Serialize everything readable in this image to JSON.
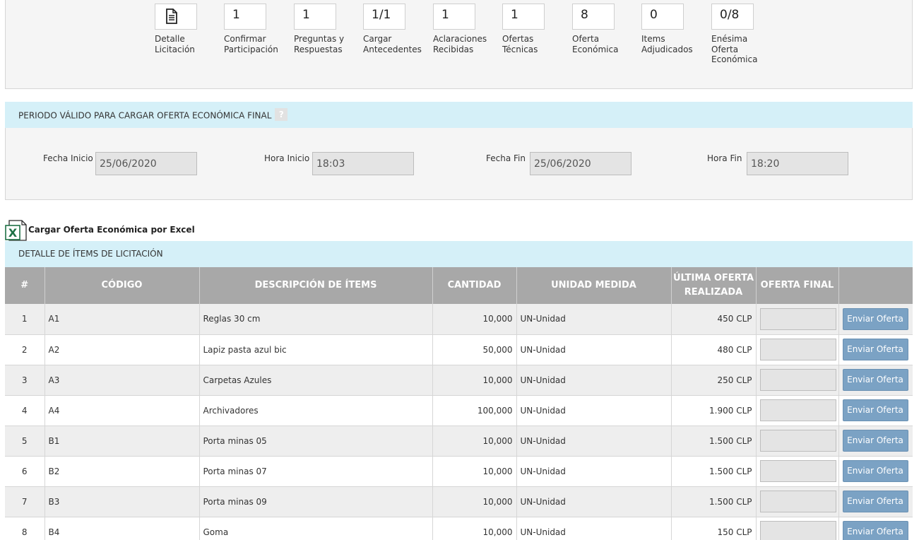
{
  "steps": [
    {
      "value": "",
      "icon": "document-icon",
      "label_l1": "Detalle",
      "label_l2": "Licitación",
      "label_l3": ""
    },
    {
      "value": "1",
      "label_l1": "Confirmar",
      "label_l2": "Participación",
      "label_l3": ""
    },
    {
      "value": "1",
      "label_l1": "Preguntas y",
      "label_l2": "Respuestas",
      "label_l3": ""
    },
    {
      "value": "1/1",
      "label_l1": "Cargar",
      "label_l2": "Antecedentes",
      "label_l3": ""
    },
    {
      "value": "1",
      "label_l1": "Aclaraciones",
      "label_l2": "Recibidas",
      "label_l3": ""
    },
    {
      "value": "1",
      "label_l1": "Ofertas",
      "label_l2": "Técnicas",
      "label_l3": ""
    },
    {
      "value": "8",
      "label_l1": "Oferta",
      "label_l2": "Económica",
      "label_l3": ""
    },
    {
      "value": "0",
      "label_l1": "Items",
      "label_l2": "Adjudicados",
      "label_l3": ""
    },
    {
      "value": "0/8",
      "label_l1": "Enésima",
      "label_l2": "Oferta",
      "label_l3": "Económica"
    }
  ],
  "periodo": {
    "title": "PERIODO VÁLIDO PARA CARGAR OFERTA ECONÓMICA FINAL",
    "help": "?",
    "fecha_inicio_label": "Fecha Inicio",
    "fecha_inicio": "25/06/2020",
    "hora_inicio_label": "Hora Inicio",
    "hora_inicio": "18:03",
    "fecha_fin_label": "Fecha Fin",
    "fecha_fin": "25/06/2020",
    "hora_fin_label": "Hora Fin",
    "hora_fin": "18:20"
  },
  "excel": {
    "label": "Cargar Oferta Económica por Excel",
    "icon": "excel-icon",
    "icon_letter": "X"
  },
  "detalle": {
    "title": "DETALLE DE ÍTEMS DE LICITACIÓN"
  },
  "table": {
    "headers": {
      "num": "#",
      "codigo": "CÓDIGO",
      "descripcion": "DESCRIPCIÓN DE ÍTEMS",
      "cantidad": "CANTIDAD",
      "unidad": "UNIDAD MEDIDA",
      "ultima_l1": "ÚLTIMA OFERTA",
      "ultima_l2": "REALIZADA",
      "final": "OFERTA FINAL"
    },
    "button_label": "Enviar Oferta",
    "rows": [
      {
        "num": "1",
        "codigo": "A1",
        "descripcion": "Reglas 30 cm",
        "cantidad": "10,000",
        "unidad": "UN-Unidad",
        "ultima": "450 CLP"
      },
      {
        "num": "2",
        "codigo": "A2",
        "descripcion": "Lapiz pasta azul bic",
        "cantidad": "50,000",
        "unidad": "UN-Unidad",
        "ultima": "480 CLP"
      },
      {
        "num": "3",
        "codigo": "A3",
        "descripcion": "Carpetas Azules",
        "cantidad": "10,000",
        "unidad": "UN-Unidad",
        "ultima": "250 CLP"
      },
      {
        "num": "4",
        "codigo": "A4",
        "descripcion": "Archivadores",
        "cantidad": "100,000",
        "unidad": "UN-Unidad",
        "ultima": "1.900 CLP"
      },
      {
        "num": "5",
        "codigo": "B1",
        "descripcion": "Porta minas 05",
        "cantidad": "10,000",
        "unidad": "UN-Unidad",
        "ultima": "1.500 CLP"
      },
      {
        "num": "6",
        "codigo": "B2",
        "descripcion": "Porta minas 07",
        "cantidad": "10,000",
        "unidad": "UN-Unidad",
        "ultima": "1.500 CLP"
      },
      {
        "num": "7",
        "codigo": "B3",
        "descripcion": "Porta minas 09",
        "cantidad": "10,000",
        "unidad": "UN-Unidad",
        "ultima": "1.500 CLP"
      },
      {
        "num": "8",
        "codigo": "B4",
        "descripcion": "Goma",
        "cantidad": "10,000",
        "unidad": "UN-Unidad",
        "ultima": "150 CLP"
      }
    ]
  }
}
